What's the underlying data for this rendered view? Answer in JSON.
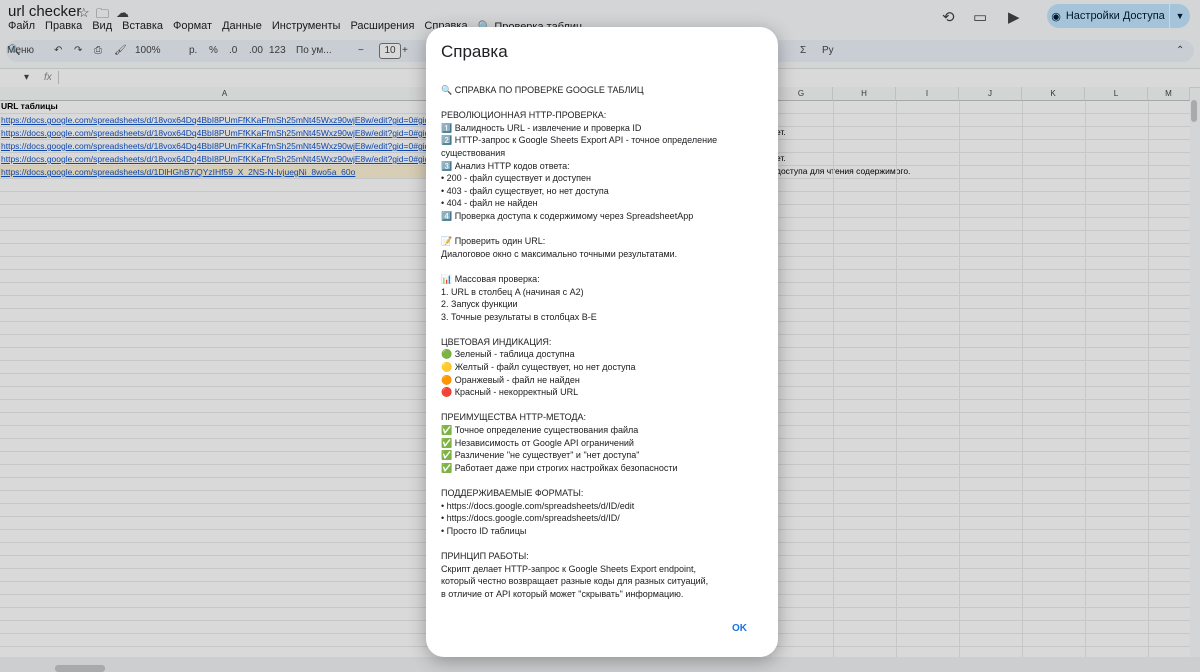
{
  "app": {
    "doc_title": "url checker",
    "share_label": "Настройки Доступа"
  },
  "menu": [
    "Файл",
    "Правка",
    "Вид",
    "Вставка",
    "Формат",
    "Данные",
    "Инструменты",
    "Расширения",
    "Справка",
    "🔍 Проверка таблиц"
  ],
  "toolbar": {
    "menus_label": "Меню",
    "zoom": "100%",
    "currency": "р.",
    "percent": "%",
    "dec_decrease": ".0",
    "dec_increase": ".00",
    "format_number": "123",
    "font": "По ум...",
    "font_size": "10",
    "sigma": "Σ",
    "input_tools": "Ру"
  },
  "formula_bar": {
    "fx": "fx"
  },
  "columns": [
    "A",
    "G",
    "H",
    "I",
    "J",
    "K",
    "L",
    "M"
  ],
  "sheet": {
    "header": "URL таблицы",
    "urls": [
      "https://docs.google.com/spreadsheets/d/18vox64Dq4BbI8PUmFfKKaFfmSh25mNt45Wxz90wjE8w/edit?gid=0#gid=0",
      "https://docs.google.com/spreadsheets/d/18vox64Dq4BbI8PUmFfKKaFfmSh25mNt45Wxz90wjE8w/edit?gid=0#gid=0",
      "https://docs.google.com/spreadsheets/d/18vox64Dq4BbI8PUmFfKKaFfmSh25mNt45Wxz90wjE8w/edit?gid=0#gid=0",
      "https://docs.google.com/spreadsheets/d/18vox64Dq4BbI8PUmFfKKaFfmSh25mNt45Wxz90wjE8w/edit?gid=0#gid=0",
      "https://docs.google.com/spreadsheets/d/1DlHGhB7iQYzIHf59_X_2NS-N-lvjuegNi_8wo5a_60o"
    ],
    "right_texts": [
      "ет.",
      "ет.",
      "доступа для чтения содержимого."
    ]
  },
  "dialog": {
    "title": "Справка",
    "ok_label": "OK",
    "lines": [
      "🔍 СПРАВКА ПО ПРОВЕРКЕ GOOGLE ТАБЛИЦ",
      "",
      "РЕВОЛЮЦИОННАЯ HTTP-ПРОВЕРКА:",
      "1️⃣ Валидность URL - извлечение и проверка ID",
      "2️⃣ HTTP-запрос к Google Sheets Export API - точное определение",
      "существования",
      "3️⃣ Анализ HTTP кодов ответа:",
      "• 200 - файл существует и доступен",
      "• 403 - файл существует, но нет доступа",
      "• 404 - файл не найден",
      "4️⃣ Проверка доступа к содержимому через SpreadsheetApp",
      "",
      "📝 Проверить один URL:",
      "Диалоговое окно с максимально точными результатами.",
      "",
      "📊 Массовая проверка:",
      "1. URL в столбец A (начиная с A2)",
      "2. Запуск функции",
      "3. Точные результаты в столбцах B-E",
      "",
      "ЦВЕТОВАЯ ИНДИКАЦИЯ:",
      "🟢 Зеленый - таблица доступна",
      "🟡 Желтый - файл существует, но нет доступа",
      "🟠 Оранжевый - файл не найден",
      "🔴 Красный - некорректный URL",
      "",
      "ПРЕИМУЩЕСТВА HTTP-МЕТОДА:",
      "✅ Точное определение существования файла",
      "✅ Независимость от Google API ограничений",
      "✅ Различение \"не существует\" и \"нет доступа\"",
      "✅ Работает даже при строгих настройках безопасности",
      "",
      "ПОДДЕРЖИВАЕМЫЕ ФОРМАТЫ:",
      "• https://docs.google.com/spreadsheets/d/ID/edit",
      "• https://docs.google.com/spreadsheets/d/ID/",
      "• Просто ID таблицы",
      "",
      "ПРИНЦИП РАБОТЫ:",
      "Скрипт делает HTTP-запрос к Google Sheets Export endpoint,",
      "который честно возвращает разные коды для разных ситуаций,",
      "в отличие от API который может \"скрывать\" информацию."
    ]
  }
}
